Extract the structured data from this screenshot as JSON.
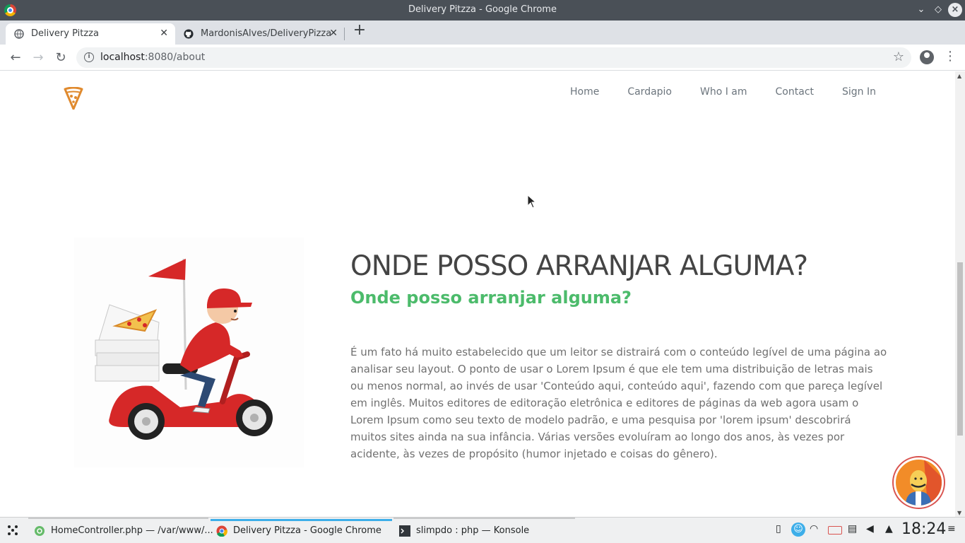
{
  "window": {
    "title": "Delivery Pitzza - Google Chrome"
  },
  "tabs": [
    {
      "label": "Delivery Pitzza",
      "active": true
    },
    {
      "label": "MardonisAlves/DeliveryPizza",
      "active": false
    }
  ],
  "address_bar": {
    "host": "localhost",
    "rest": ":8080/about"
  },
  "site_nav": {
    "items": [
      "Home",
      "Cardapio",
      "Who I am",
      "Contact",
      "Sign In"
    ]
  },
  "content": {
    "heading": "ONDE POSSO ARRANJAR ALGUMA?",
    "subheading": "Onde posso arranjar alguma?",
    "paragraph_lines": [
      "É um fato há muito estabelecido que um leitor se distrairá com o conteúdo legível de uma página ao",
      "analisar seu layout. O ponto de usar o Lorem Ipsum é que ele tem uma distribuição de letras mais",
      "ou menos normal, ao invés de usar 'Conteúdo aqui, conteúdo aqui', fazendo com que pareça legível",
      "em inglês. Muitos editores de editoração eletrônica e editores de páginas da web agora usam o",
      "Lorem Ipsum como seu texto de modelo padrão, e uma pesquisa por 'lorem ipsum' descobrirá",
      "muitos sites ainda na sua infância. Várias versões evoluíram ao longo dos anos, às vezes por",
      "acidente, às vezes de propósito (humor injetado e coisas do gênero)."
    ]
  },
  "taskbar": {
    "tasks": [
      {
        "label": "HomeController.php — /var/www/..."
      },
      {
        "label": "Delivery Pitzza - Google Chrome"
      },
      {
        "label": "slimpdo : php — Konsole"
      }
    ],
    "clock": "18:24"
  },
  "colors": {
    "accent_green": "#4cbb6b",
    "logo_orange": "#e08a2e",
    "kde_blue": "#3daee9"
  }
}
